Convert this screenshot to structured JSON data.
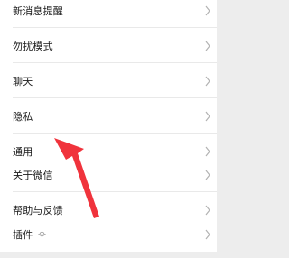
{
  "settings": {
    "group1": [
      {
        "label": "新消息提醒"
      },
      {
        "label": "勿扰模式"
      },
      {
        "label": "聊天"
      },
      {
        "label": "隐私"
      },
      {
        "label": "通用"
      }
    ],
    "group2": [
      {
        "label": "关于微信"
      },
      {
        "label": "帮助与反馈"
      }
    ],
    "group3": [
      {
        "label": "插件"
      }
    ]
  },
  "colors": {
    "background": "#ededed",
    "row_background": "#ffffff",
    "annotation_arrow": "#f0333c"
  },
  "icons": {
    "row_chevron": "chevron-right-icon",
    "plugin_badge": "gear-icon"
  }
}
